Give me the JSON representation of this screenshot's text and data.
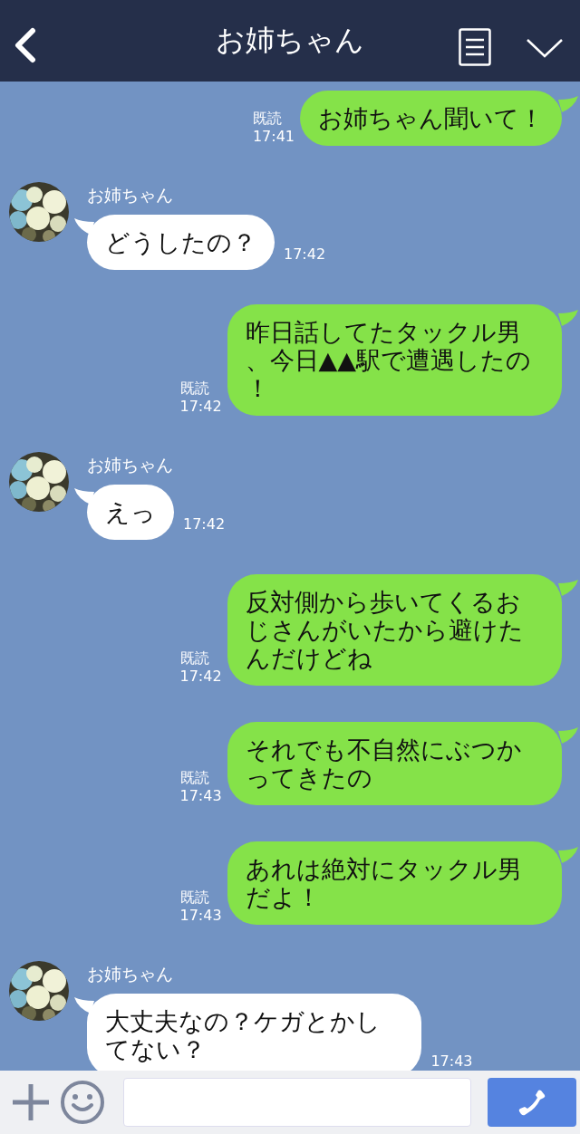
{
  "header": {
    "title": "お姉ちゃん"
  },
  "messages": [
    {
      "kind": "sent",
      "text": "お姉ちゃん聞いて！",
      "read": "既読",
      "time": "17:41"
    },
    {
      "kind": "received",
      "sender": "お姉ちゃん",
      "text": "どうしたの？",
      "time": "17:42"
    },
    {
      "kind": "sent",
      "text": "昨日話してたタックル男、今日▲▲駅で遭遇したの！",
      "read": "既読",
      "time": "17:42"
    },
    {
      "kind": "received",
      "sender": "お姉ちゃん",
      "text": "えっ",
      "time": "17:42"
    },
    {
      "kind": "sent",
      "text": "反対側から歩いてくるおじさんがいたから避けたんだけどね",
      "read": "既読",
      "time": "17:42"
    },
    {
      "kind": "sent",
      "text": "それでも不自然にぶつかってきたの",
      "read": "既読",
      "time": "17:43"
    },
    {
      "kind": "sent",
      "text": "あれは絶対にタックル男だよ！",
      "read": "既読",
      "time": "17:43"
    },
    {
      "kind": "received",
      "sender": "お姉ちゃん",
      "text": "大丈夫なの？ケガとかしてない？",
      "time": "17:43"
    }
  ]
}
